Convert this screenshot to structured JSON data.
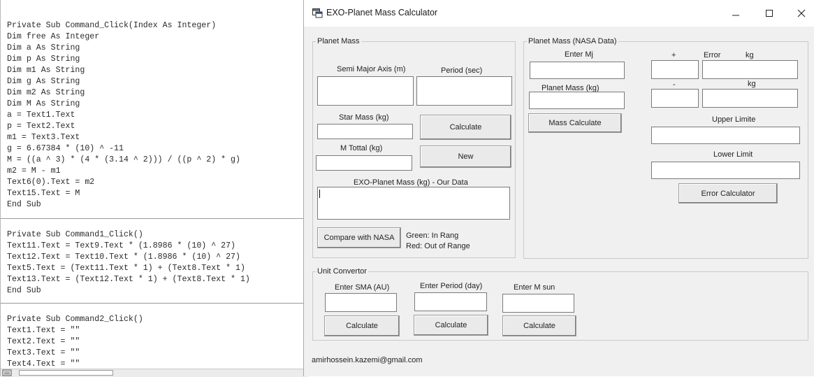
{
  "code": {
    "block1": [
      "Private Sub Command_Click(Index As Integer)",
      "Dim free As Integer",
      "Dim a As String",
      "Dim p As String",
      "Dim m1 As String",
      "Dim g As String",
      "Dim m2 As String",
      "Dim M As String",
      "a = Text1.Text",
      "p = Text2.Text",
      "m1 = Text3.Text",
      "g = 6.67384 * (10) ^ -11",
      "M = ((a ^ 3) * (4 * (3.14 ^ 2))) / ((p ^ 2) * g)",
      "m2 = M - m1",
      "Text6(0).Text = m2",
      "Text15.Text = M",
      "End Sub"
    ],
    "block2": [
      "Private Sub Command1_Click()",
      "Text11.Text = Text9.Text * (1.8986 * (10) ^ 27)",
      "Text12.Text = Text10.Text * (1.8986 * (10) ^ 27)",
      "Text5.Text = (Text11.Text * 1) + (Text8.Text * 1)",
      "Text13.Text = (Text12.Text * 1) + (Text8.Text * 1)",
      "End Sub"
    ],
    "block3": [
      "Private Sub Command2_Click()",
      "Text1.Text = \"\"",
      "Text2.Text = \"\"",
      "Text3.Text = \"\"",
      "Text4.Text = \"\""
    ]
  },
  "window": {
    "title": "EXO-Planet Mass Calculator",
    "icon": "vb-form-icon",
    "controls": [
      "minimize-icon",
      "maximize-icon",
      "close-icon"
    ]
  },
  "planet_mass": {
    "group_label": "Planet Mass",
    "sma_label": "Semi Major Axis (m)",
    "period_label": "Period (sec)",
    "star_mass_label": "Star Mass (kg)",
    "calculate_button": "Calculate",
    "m_total_label": "M Tottal (kg)",
    "new_button": "New",
    "exo_mass_label": "EXO-Planet Mass (kg) - Our Data",
    "compare_button": "Compare with NASA",
    "green_legend": "Green: In Rang",
    "red_legend": "Red: Out of Range"
  },
  "nasa": {
    "group_label": "Planet Mass (NASA Data)",
    "enter_mj_label": "Enter Mj",
    "plus_label": "+",
    "error_label": "Error",
    "kg_label_1": "kg",
    "planet_mass_label": "Planet Mass (kg)",
    "minus_label": "-",
    "kg_label_2": "kg",
    "mass_calc_button": "Mass Calculate",
    "upper_label": "Upper Limite",
    "lower_label": "Lower Limit",
    "error_calc_button": "Error Calculator"
  },
  "unit_convertor": {
    "group_label": "Unit Convertor",
    "sma_au_label": "Enter SMA (AU)",
    "period_day_label": "Enter Period (day)",
    "m_sun_label": "Enter M sun",
    "calculate_1": "Calculate",
    "calculate_2": "Calculate",
    "calculate_3": "Calculate"
  },
  "footer": {
    "email": "amirhossein.kazemi@gmail.com"
  }
}
